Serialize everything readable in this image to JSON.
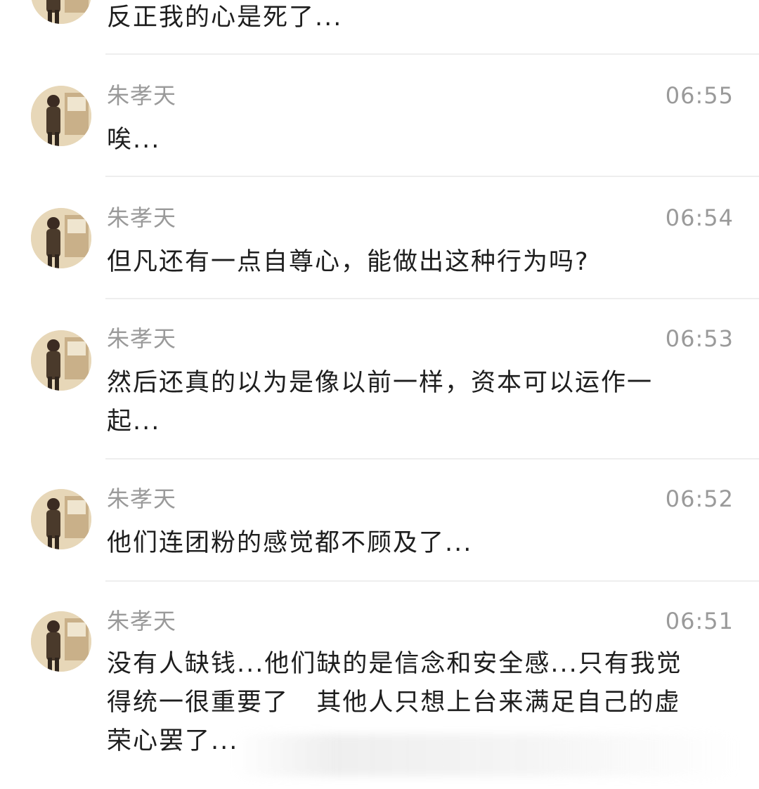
{
  "top_message": {
    "text": "反正我的心是死了..."
  },
  "messages": [
    {
      "name": "朱孝天",
      "time": "06:55",
      "text": "唉..."
    },
    {
      "name": "朱孝天",
      "time": "06:54",
      "text": "但凡还有一点自尊心，能做出这种行为吗?"
    },
    {
      "name": "朱孝天",
      "time": "06:53",
      "text": "然后还真的以为是像以前一样，资本可以运作一\n起..."
    },
    {
      "name": "朱孝天",
      "time": "06:52",
      "text": "他们连团粉的感觉都不顾及了..."
    },
    {
      "name": "朱孝天",
      "time": "06:51",
      "text": "没有人缺钱...他们缺的是信念和安全感...只有我觉\n得统一很重要了   其他人只想上台来满足自己的虚\n荣心罢了..."
    }
  ],
  "icons": {
    "avatar": "avatar-photo-icon"
  }
}
